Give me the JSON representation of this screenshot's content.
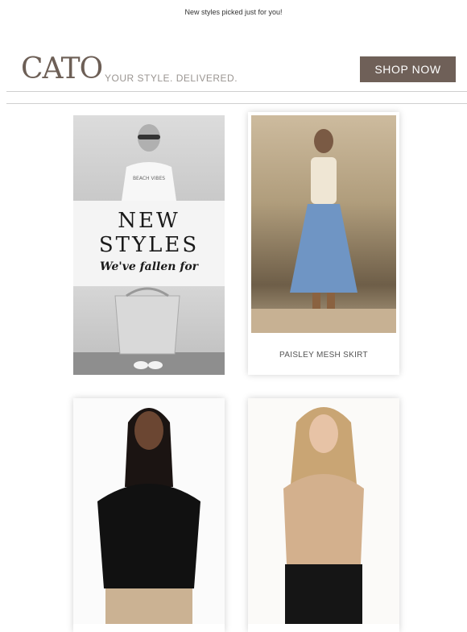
{
  "preheader": "New styles picked just for you!",
  "header": {
    "logo": "CATO",
    "tagline": "YOUR STYLE. DELIVERED.",
    "shop_now": "SHOP NOW"
  },
  "hero": {
    "line1": "NEW",
    "line2": "STYLES",
    "script": "We've fallen for"
  },
  "products": [
    {
      "label": "PAISLEY MESH SKIRT"
    }
  ]
}
